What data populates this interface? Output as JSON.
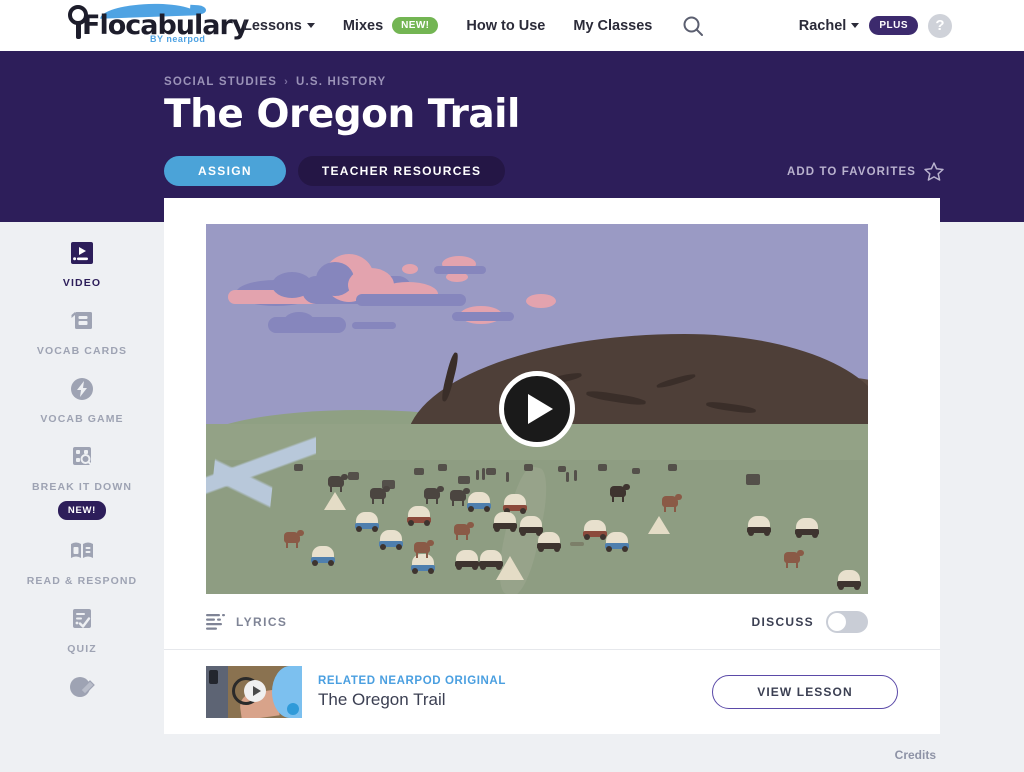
{
  "nav": {
    "logo_text": "Flocabulary",
    "logo_sub": "BY nearpod",
    "items": [
      {
        "label": "Lessons",
        "has_caret": true,
        "badge": null
      },
      {
        "label": "Mixes",
        "has_caret": false,
        "badge": "NEW!"
      },
      {
        "label": "How to Use",
        "has_caret": false,
        "badge": null
      },
      {
        "label": "My Classes",
        "has_caret": false,
        "badge": null
      }
    ],
    "search_icon": "search-icon",
    "user_name": "Rachel",
    "plus_badge": "PLUS",
    "help_label": "?"
  },
  "hero": {
    "breadcrumb": [
      "SOCIAL STUDIES",
      "U.S. HISTORY"
    ],
    "breadcrumb_separator": "›",
    "title": "The Oregon Trail",
    "assign_label": "ASSIGN",
    "teacher_resources_label": "TEACHER RESOURCES",
    "favorites_label": "ADD TO FAVORITES",
    "favorites_icon": "star-outline-icon",
    "bg_color": "#2d1e5a",
    "assign_color": "#4ba3d8"
  },
  "sidebar": {
    "items": [
      {
        "label": "VIDEO",
        "icon": "video-icon",
        "active": true,
        "badge": null
      },
      {
        "label": "VOCAB CARDS",
        "icon": "cards-icon",
        "active": false,
        "badge": null
      },
      {
        "label": "VOCAB GAME",
        "icon": "lightning-icon",
        "active": false,
        "badge": null
      },
      {
        "label": "BREAK IT DOWN",
        "icon": "magnifier-grid-icon",
        "active": false,
        "badge": "NEW!"
      },
      {
        "label": "READ & RESPOND",
        "icon": "open-book-icon",
        "active": false,
        "badge": null
      },
      {
        "label": "QUIZ",
        "icon": "checklist-icon",
        "active": false,
        "badge": null
      },
      {
        "label": "",
        "icon": "pencil-circle-icon",
        "active": false,
        "badge": null
      }
    ]
  },
  "video": {
    "alt": "Illustration of covered wagons, oxen and horses crossing green plains beneath a large brown butte and a purple sky with pink clouds",
    "play_icon": "play-icon",
    "lyrics_label": "LYRICS",
    "lyrics_icon": "lyrics-lines-icon",
    "discuss_label": "DISCUSS",
    "discuss_on": false
  },
  "related": {
    "kicker": "RELATED NEARPOD ORIGINAL",
    "title": "The Oregon Trail",
    "button_label": "VIEW LESSON",
    "thumb_icon": "play-icon"
  },
  "footer": {
    "credits_label": "Credits"
  }
}
